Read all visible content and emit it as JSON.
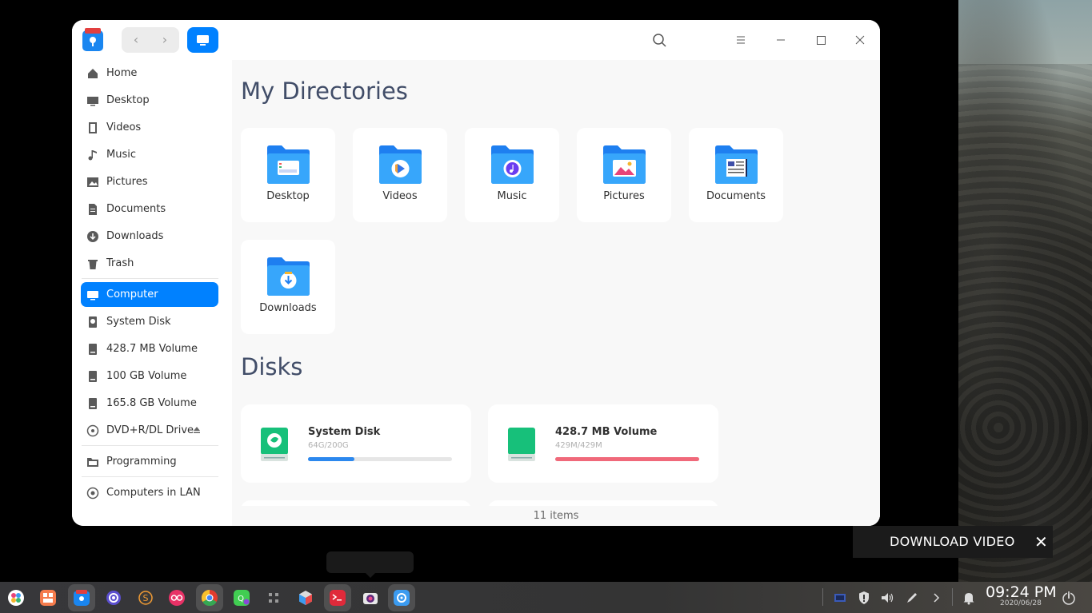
{
  "window": {
    "sidebar": {
      "items": [
        {
          "label": "Home",
          "icon": "home-icon"
        },
        {
          "label": "Desktop",
          "icon": "desktop-icon"
        },
        {
          "label": "Videos",
          "icon": "videos-icon"
        },
        {
          "label": "Music",
          "icon": "music-icon"
        },
        {
          "label": "Pictures",
          "icon": "pictures-icon"
        },
        {
          "label": "Documents",
          "icon": "documents-icon"
        },
        {
          "label": "Downloads",
          "icon": "downloads-icon"
        },
        {
          "label": "Trash",
          "icon": "trash-icon"
        },
        {
          "label": "Computer",
          "icon": "computer-icon",
          "active": true
        },
        {
          "label": "System Disk",
          "icon": "system-disk-icon"
        },
        {
          "label": "428.7 MB Volume",
          "icon": "volume-icon"
        },
        {
          "label": "100 GB Volume",
          "icon": "volume-icon"
        },
        {
          "label": "165.8 GB Volume",
          "icon": "volume-icon"
        },
        {
          "label": "DVD+R/DL Drive",
          "icon": "dvd-icon"
        },
        {
          "label": "Programming",
          "icon": "folder-icon"
        },
        {
          "label": "Computers in LAN",
          "icon": "network-icon"
        }
      ]
    },
    "main": {
      "directories_title": "My Directories",
      "directories": [
        {
          "label": "Desktop"
        },
        {
          "label": "Videos"
        },
        {
          "label": "Music"
        },
        {
          "label": "Pictures"
        },
        {
          "label": "Documents"
        },
        {
          "label": "Downloads"
        }
      ],
      "disks_title": "Disks",
      "disks": [
        {
          "name": "System Disk",
          "size": "64G/200G",
          "usage": 0.32,
          "color": "#2c88ee"
        },
        {
          "name": "428.7 MB Volume",
          "size": "429M/429M",
          "usage": 1.0,
          "color": "#f0697a"
        }
      ]
    },
    "status": "11 items"
  },
  "overlay": {
    "download_label": "DOWNLOAD VIDEO",
    "close_symbol": "✕"
  },
  "taskbar": {
    "time": "09:24 PM",
    "date": "2020/06/28"
  },
  "colors": {
    "accent": "#0081ff",
    "title_text": "#414d68"
  }
}
